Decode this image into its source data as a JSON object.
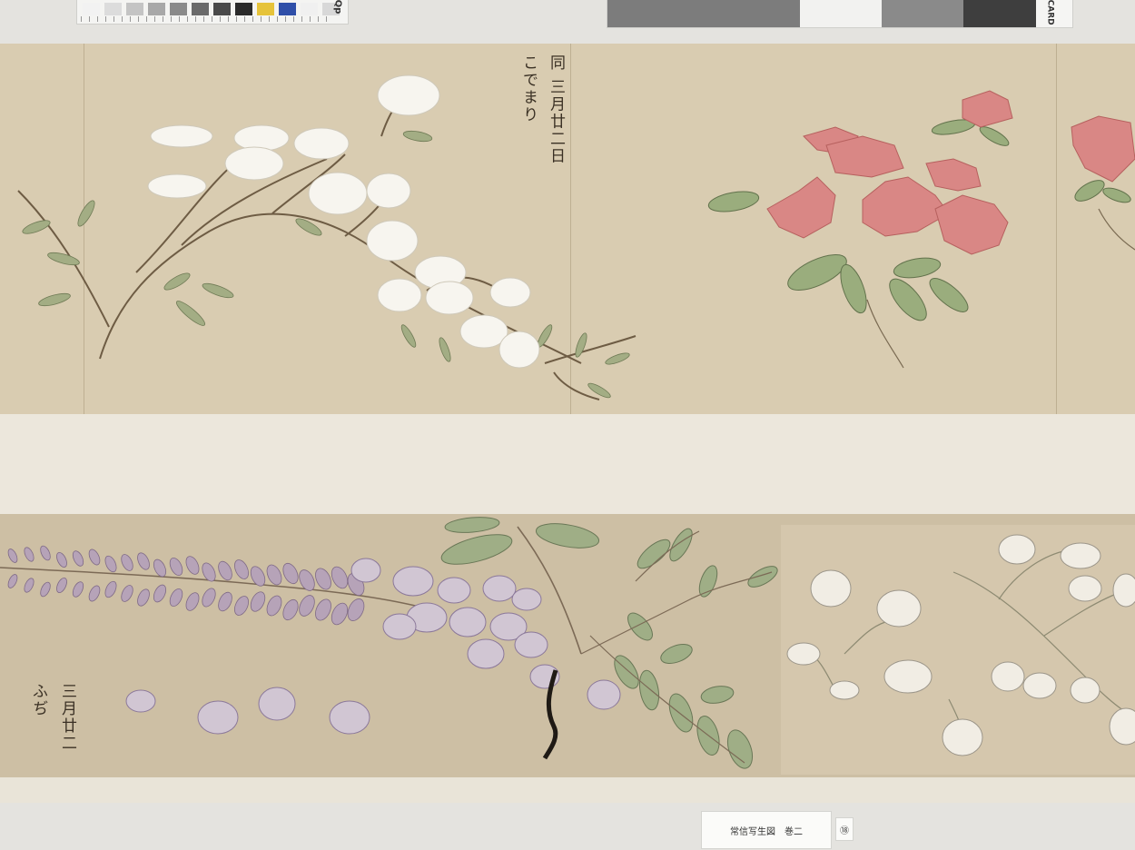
{
  "label": {
    "title": "常信写生図　巻二",
    "plate_number": "⑱"
  },
  "inscriptions": {
    "upper_col1": "同 三月廿二日",
    "upper_col2": "こでまり",
    "lower_col1": "三月廿二",
    "lower_col2": "ふぢ"
  },
  "calibration": {
    "left_brand": "Qp",
    "right_brand": "Qp CARD",
    "left_swatches": [
      "#f2f2f2",
      "#dcdcdc",
      "#c4c4c4",
      "#a8a8a8",
      "#8a8a8a",
      "#6a6a6a",
      "#4a4a4a",
      "#2a2a2a",
      "#e6c33a",
      "#2f4fa8",
      "#f0f0f0",
      "#d8d8d8"
    ],
    "right_swatches": [
      "#7c7c7c",
      "#f2f2f0",
      "#8a8a8a",
      "#3e3e3e"
    ]
  },
  "colors": {
    "paper_upper": "#d9ccb1",
    "paper_lower": "#cdbfa4",
    "azalea_pink": "#d97a78",
    "spiraea_white": "#f7f5ef",
    "wisteria_purple": "#9b88a6",
    "leaf_green": "#8fa675"
  }
}
